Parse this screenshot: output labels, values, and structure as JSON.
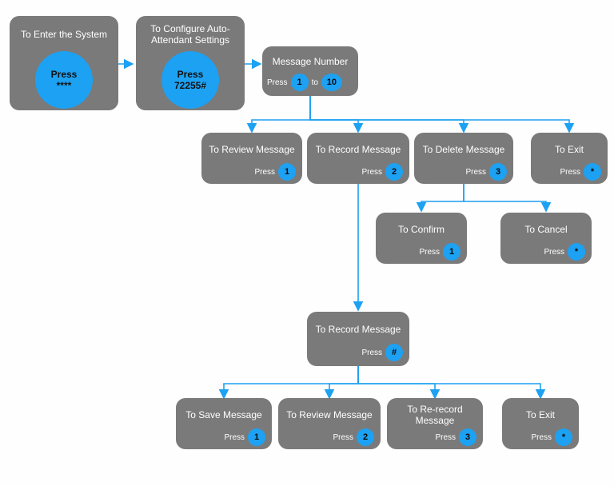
{
  "colors": {
    "node": "#7a7a7a",
    "accent": "#1da1f2",
    "arrow": "#1da1f2"
  },
  "start1": {
    "title": "To Enter the System",
    "press_label": "Press",
    "code": "****"
  },
  "start2": {
    "title": "To Configure Auto-Attendant Settings",
    "press_label": "Press",
    "code": "72255#"
  },
  "msgnum": {
    "title": "Message Number",
    "press_label": "Press",
    "from": "1",
    "to_label": "to",
    "to": "10"
  },
  "level1": {
    "review": {
      "title": "To Review Message",
      "press_label": "Press",
      "key": "1"
    },
    "record": {
      "title": "To Record Message",
      "press_label": "Press",
      "key": "2"
    },
    "delete": {
      "title": "To Delete Message",
      "press_label": "Press",
      "key": "3"
    },
    "exit": {
      "title": "To Exit",
      "press_label": "Press",
      "key": "*"
    }
  },
  "delete_children": {
    "confirm": {
      "title": "To Confirm",
      "press_label": "Press",
      "key": "1"
    },
    "cancel": {
      "title": "To Cancel",
      "press_label": "Press",
      "key": "*"
    }
  },
  "record2": {
    "title": "To Record Message",
    "press_label": "Press",
    "key": "#"
  },
  "level3": {
    "save": {
      "title": "To Save Message",
      "press_label": "Press",
      "key": "1"
    },
    "review": {
      "title": "To Review Message",
      "press_label": "Press",
      "key": "2"
    },
    "rerecord": {
      "title": "To Re-record Message",
      "press_label": "Press",
      "key": "3"
    },
    "exit": {
      "title": "To Exit",
      "press_label": "Press",
      "key": "*"
    }
  }
}
